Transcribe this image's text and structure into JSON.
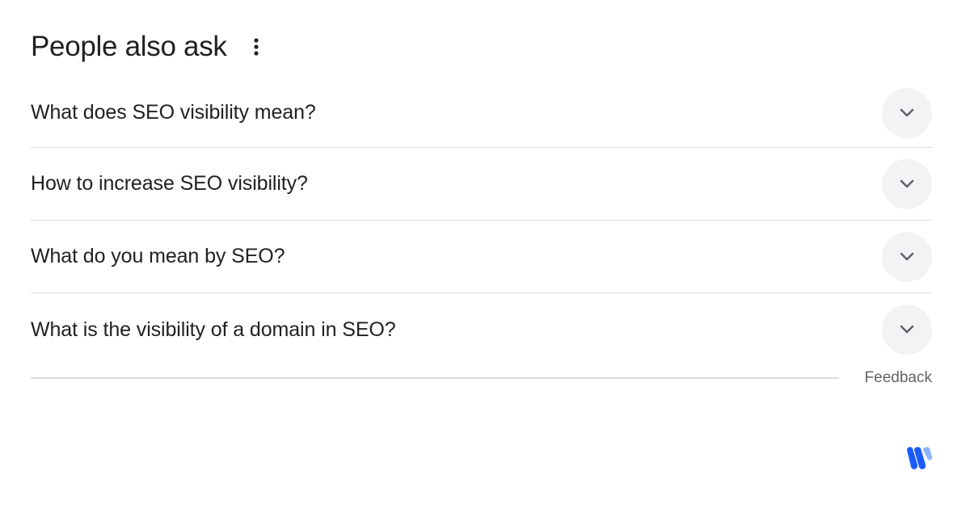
{
  "paa": {
    "title": "People also ask",
    "more_icon": "more-vertical-icon",
    "questions": [
      {
        "text": "What does SEO visibility mean?",
        "icon": "chevron-down-icon"
      },
      {
        "text": "How to increase SEO visibility?",
        "icon": "chevron-down-icon"
      },
      {
        "text": "What do you mean by SEO?",
        "icon": "chevron-down-icon"
      },
      {
        "text": "What is the visibility of a domain in SEO?",
        "icon": "chevron-down-icon"
      }
    ]
  },
  "footer": {
    "feedback_label": "Feedback"
  },
  "brand": {
    "logo_icon": "w-logo-icon",
    "logo_colors": [
      "#1a5cff",
      "#4d8bff",
      "#8fb4ff"
    ]
  },
  "colors": {
    "text": "#202124",
    "muted": "#5f6368",
    "divider": "#dadce0",
    "chevron_bg": "#f1f3f4"
  }
}
